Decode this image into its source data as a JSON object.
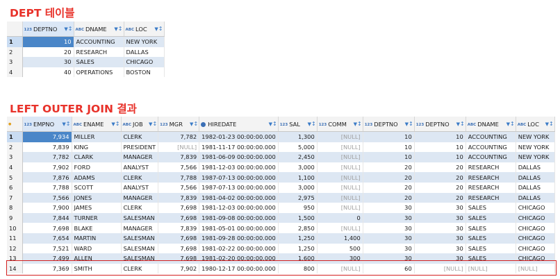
{
  "dept_title": "DEPT 테이블",
  "join_title": "LEFT OUTER JOIN 결과",
  "null_text": "[NULL]",
  "accent_colors": {
    "heading": "#e8322a",
    "highlight_box": "#d32020",
    "row_alt": "#dde7f3"
  },
  "dept": {
    "columns": [
      {
        "type": "123",
        "name": "DEPTNO"
      },
      {
        "type": "ABC",
        "name": "DNAME"
      },
      {
        "type": "ABC",
        "name": "LOC"
      }
    ],
    "rows": [
      {
        "n": "1",
        "cells": [
          "10",
          "ACCOUNTING",
          "NEW YORK"
        ]
      },
      {
        "n": "2",
        "cells": [
          "20",
          "RESEARCH",
          "DALLAS"
        ]
      },
      {
        "n": "3",
        "cells": [
          "30",
          "SALES",
          "CHICAGO"
        ]
      },
      {
        "n": "4",
        "cells": [
          "40",
          "OPERATIONS",
          "BOSTON"
        ]
      }
    ]
  },
  "join": {
    "columns": [
      {
        "type": "123",
        "name": "EMPNO"
      },
      {
        "type": "ABC",
        "name": "ENAME"
      },
      {
        "type": "ABC",
        "name": "JOB"
      },
      {
        "type": "123",
        "name": "MGR"
      },
      {
        "type": "clock",
        "name": "HIREDATE"
      },
      {
        "type": "123",
        "name": "SAL"
      },
      {
        "type": "123",
        "name": "COMM"
      },
      {
        "type": "123",
        "name": "DEPTNO"
      },
      {
        "type": "123",
        "name": "DEPTNO"
      },
      {
        "type": "ABC",
        "name": "DNAME"
      },
      {
        "type": "ABC",
        "name": "LOC"
      }
    ],
    "rows": [
      {
        "n": "1",
        "cells": [
          "7,934",
          "MILLER",
          "CLERK",
          "7,782",
          "1982-01-23 00:00:00.000",
          "1,300",
          "[NULL]",
          "10",
          "10",
          "ACCOUNTING",
          "NEW YORK"
        ]
      },
      {
        "n": "2",
        "cells": [
          "7,839",
          "KING",
          "PRESIDENT",
          "[NULL]",
          "1981-11-17 00:00:00.000",
          "5,000",
          "[NULL]",
          "10",
          "10",
          "ACCOUNTING",
          "NEW YORK"
        ]
      },
      {
        "n": "3",
        "cells": [
          "7,782",
          "CLARK",
          "MANAGER",
          "7,839",
          "1981-06-09 00:00:00.000",
          "2,450",
          "[NULL]",
          "10",
          "10",
          "ACCOUNTING",
          "NEW YORK"
        ]
      },
      {
        "n": "4",
        "cells": [
          "7,902",
          "FORD",
          "ANALYST",
          "7,566",
          "1981-12-03 00:00:00.000",
          "3,000",
          "[NULL]",
          "20",
          "20",
          "RESEARCH",
          "DALLAS"
        ]
      },
      {
        "n": "5",
        "cells": [
          "7,876",
          "ADAMS",
          "CLERK",
          "7,788",
          "1987-07-13 00:00:00.000",
          "1,100",
          "[NULL]",
          "20",
          "20",
          "RESEARCH",
          "DALLAS"
        ]
      },
      {
        "n": "6",
        "cells": [
          "7,788",
          "SCOTT",
          "ANALYST",
          "7,566",
          "1987-07-13 00:00:00.000",
          "3,000",
          "[NULL]",
          "20",
          "20",
          "RESEARCH",
          "DALLAS"
        ]
      },
      {
        "n": "7",
        "cells": [
          "7,566",
          "JONES",
          "MANAGER",
          "7,839",
          "1981-04-02 00:00:00.000",
          "2,975",
          "[NULL]",
          "20",
          "20",
          "RESEARCH",
          "DALLAS"
        ]
      },
      {
        "n": "8",
        "cells": [
          "7,900",
          "JAMES",
          "CLERK",
          "7,698",
          "1981-12-03 00:00:00.000",
          "950",
          "[NULL]",
          "30",
          "30",
          "SALES",
          "CHICAGO"
        ]
      },
      {
        "n": "9",
        "cells": [
          "7,844",
          "TURNER",
          "SALESMAN",
          "7,698",
          "1981-09-08 00:00:00.000",
          "1,500",
          "0",
          "30",
          "30",
          "SALES",
          "CHICAGO"
        ]
      },
      {
        "n": "10",
        "cells": [
          "7,698",
          "BLAKE",
          "MANAGER",
          "7,839",
          "1981-05-01 00:00:00.000",
          "2,850",
          "[NULL]",
          "30",
          "30",
          "SALES",
          "CHICAGO"
        ]
      },
      {
        "n": "11",
        "cells": [
          "7,654",
          "MARTIN",
          "SALESMAN",
          "7,698",
          "1981-09-28 00:00:00.000",
          "1,250",
          "1,400",
          "30",
          "30",
          "SALES",
          "CHICAGO"
        ]
      },
      {
        "n": "12",
        "cells": [
          "7,521",
          "WARD",
          "SALESMAN",
          "7,698",
          "1981-02-22 00:00:00.000",
          "1,250",
          "500",
          "30",
          "30",
          "SALES",
          "CHICAGO"
        ]
      },
      {
        "n": "13",
        "cells": [
          "7,499",
          "ALLEN",
          "SALESMAN",
          "7,698",
          "1981-02-20 00:00:00.000",
          "1,600",
          "300",
          "30",
          "30",
          "SALES",
          "CHICAGO"
        ]
      },
      {
        "n": "14",
        "cells": [
          "7,369",
          "SMITH",
          "CLERK",
          "7,902",
          "1980-12-17 00:00:00.000",
          "800",
          "[NULL]",
          "60",
          "[NULL]",
          "[NULL]",
          "[NULL]"
        ]
      }
    ]
  }
}
